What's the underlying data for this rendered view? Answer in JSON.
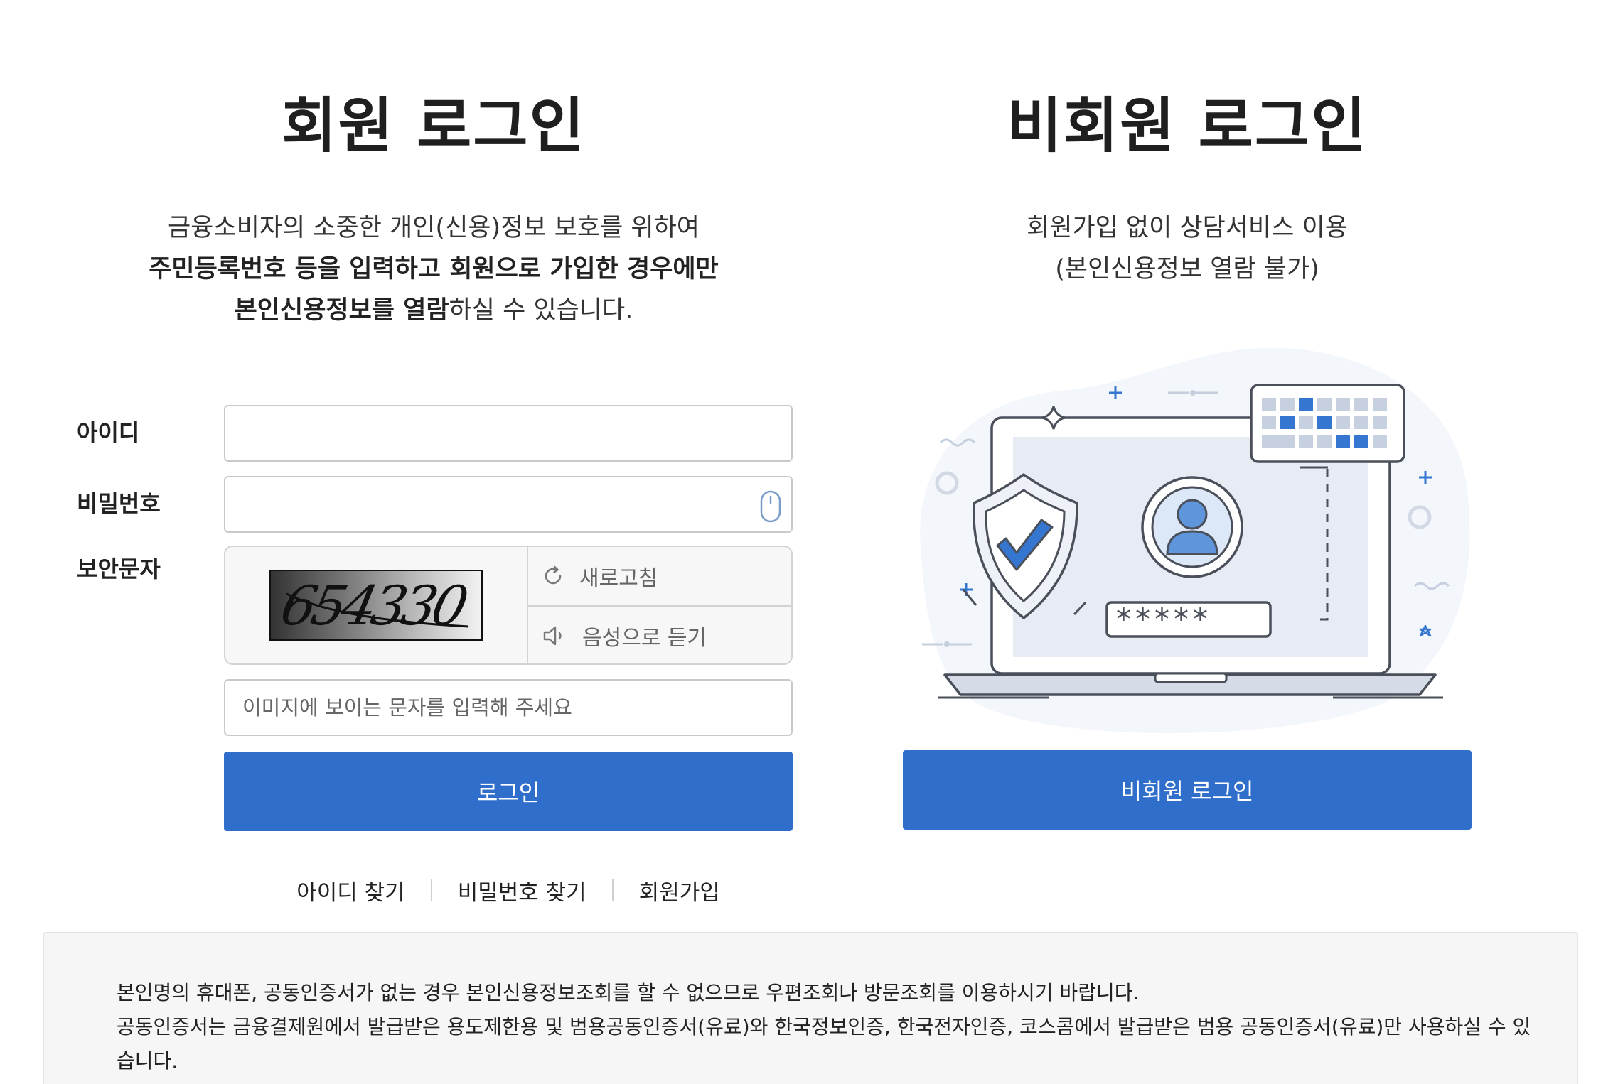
{
  "member": {
    "title": "회원 로그인",
    "desc_line1": "금융소비자의 소중한 개인(신용)정보 보호를 위하여",
    "desc_line2": "주민등록번호 등을 입력하고 회원으로 가입한 경우에만",
    "desc_line3_bold": "본인신용정보를 열람",
    "desc_line3_rest": "하실 수 있습니다.",
    "id_label": "아이디",
    "id_value": "",
    "password_label": "비밀번호",
    "password_value": "",
    "captcha_label": "보안문자",
    "captcha_text": "654330",
    "captcha_refresh_label": "새로고침",
    "captcha_audio_label": "음성으로 듣기",
    "captcha_placeholder": "이미지에 보이는 문자를 입력해 주세요",
    "login_button": "로그인",
    "find_id_link": "아이디 찾기",
    "find_password_link": "비밀번호 찾기",
    "signup_link": "회원가입"
  },
  "guest": {
    "title": "비회원 로그인",
    "desc_line1": "회원가입 없이 상담서비스 이용",
    "desc_line2": "(본인신용정보 열람 불가)",
    "password_mask": "*****",
    "login_button": "비회원 로그인"
  },
  "notice": {
    "line1": "본인명의 휴대폰, 공동인증서가 없는 경우 본인신용정보조회를 할 수 없으므로 우편조회나 방문조회를 이용하시기 바랍니다.",
    "line2": "공동인증서는 금융결제원에서 발급받은 용도제한용 및 범용공동인증서(유료)와 한국정보인증, 한국전자인증, 코스콤에서 발급받은 범용 공동인증서(유료)만 사용하실 수 있습니다."
  },
  "colors": {
    "primary_button": "#2f6fcb",
    "illustration_blue": "#3576d0",
    "illustration_light": "#e6ebf4"
  },
  "icons": {
    "password_toggle": "mouse-keyboard-icon",
    "captcha_refresh": "refresh-icon",
    "captcha_audio": "speaker-icon",
    "shield": "shield-check-icon",
    "user": "user-avatar-icon"
  }
}
